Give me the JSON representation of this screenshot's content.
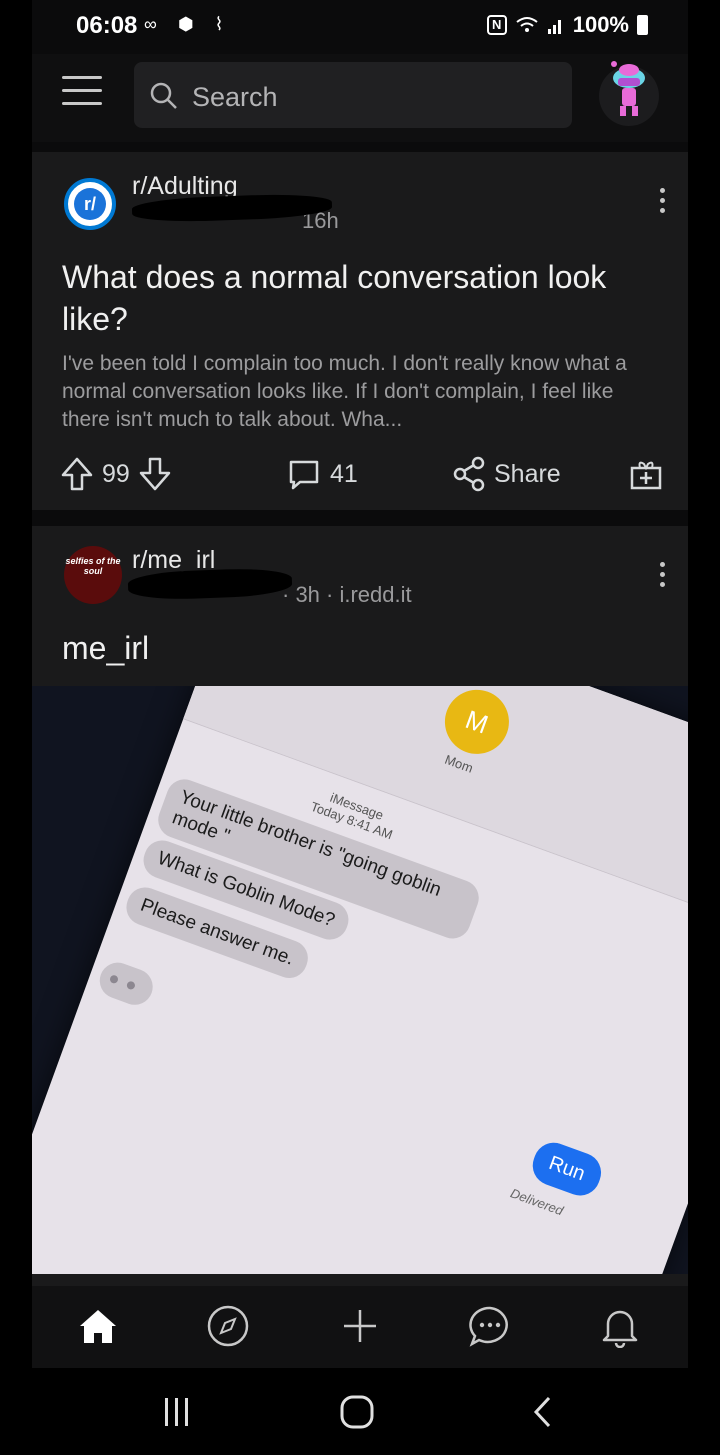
{
  "status_bar": {
    "time": "06:08",
    "left_icons": "∞ ⬢ ⌇",
    "battery": "100%",
    "nfc": "N"
  },
  "header": {
    "search_placeholder": "Search"
  },
  "posts": [
    {
      "subreddit": "r/Adulting",
      "time": "16h",
      "title": "What does a normal conversation look like?",
      "body": "I've been told I complain too much. I don't really know what a normal conversation looks like. If I don't complain, I feel like there isn't much to talk about. Wha...",
      "upvotes": "99",
      "comments": "41",
      "share_label": "Share"
    },
    {
      "subreddit": "r/me_irl",
      "meta": "· 3h · i.redd.it",
      "icon_text": "selfies of the soul",
      "title": "me_irl",
      "image": {
        "contact_initial": "M",
        "contact_name": "Mom",
        "service": "iMessage",
        "timestamp": "Today 8:41 AM",
        "messages": [
          "Your little brother is \"going goblin mode \"",
          "What is Goblin Mode?",
          "Please answer me."
        ],
        "reply": "Run",
        "reply_status": "Delivered"
      }
    }
  ],
  "colors": {
    "background": "#1a1a1b",
    "accent": "#0079d3",
    "imessage_blue": "#1c6ff0"
  }
}
